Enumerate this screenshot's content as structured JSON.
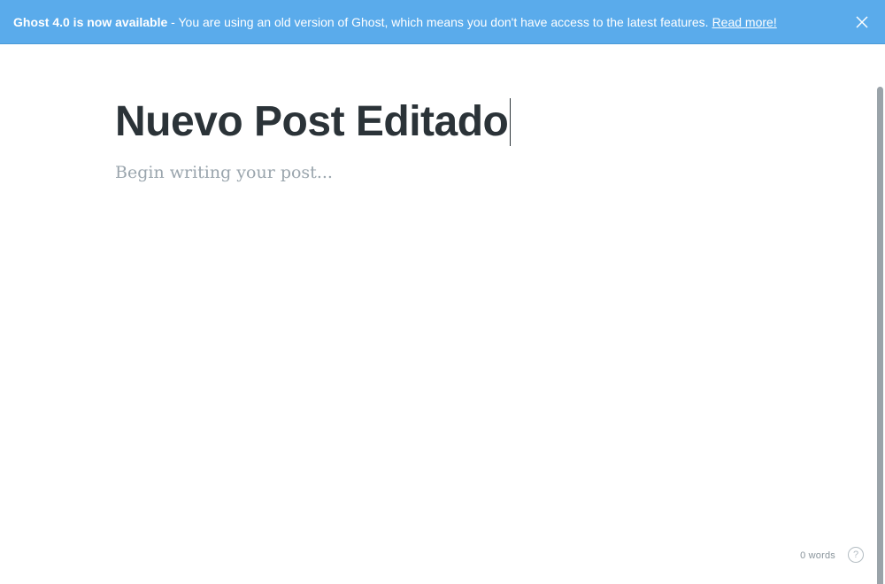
{
  "banner": {
    "headline": "Ghost 4.0 is now available",
    "message": " - You are using an old version of Ghost, which means you don't have access to the latest features.",
    "link": "Read more!",
    "close_icon": "close-icon"
  },
  "editor": {
    "title": "Nuevo Post Editado",
    "body_placeholder": "Begin writing your post..."
  },
  "footer": {
    "word_count": "0 words",
    "help_icon": "question-circle-icon",
    "help_glyph": "?"
  },
  "colors": {
    "banner_bg": "#5aabeb",
    "title_text": "#2b3338",
    "placeholder_text": "#9aa5ad"
  }
}
